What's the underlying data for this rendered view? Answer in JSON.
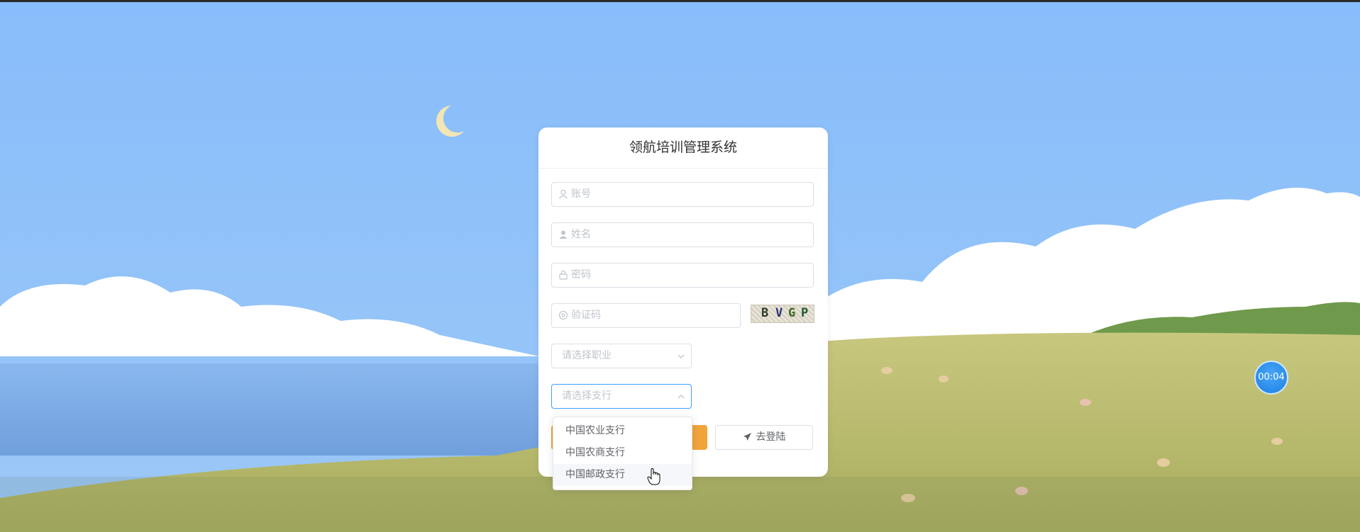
{
  "app": {
    "title": "领航培训管理系统"
  },
  "form": {
    "account_placeholder": "账号",
    "name_placeholder": "姓名",
    "password_placeholder": "密码",
    "captcha_placeholder": "验证码",
    "captcha_chars": [
      "B",
      "V",
      "G",
      "P"
    ],
    "job_select_placeholder": "请选择职业",
    "branch_select_placeholder": "请选择支行"
  },
  "dropdown": {
    "options": [
      "中国农业支行",
      "中国农商支行",
      "中国邮政支行"
    ],
    "hovered_index": 2
  },
  "buttons": {
    "login_label": "去登陆"
  },
  "timer": {
    "value": "00:04"
  },
  "colors": {
    "primary": "#409eff",
    "register_button": "#f0a43a",
    "timer": "#1b7fe3"
  }
}
